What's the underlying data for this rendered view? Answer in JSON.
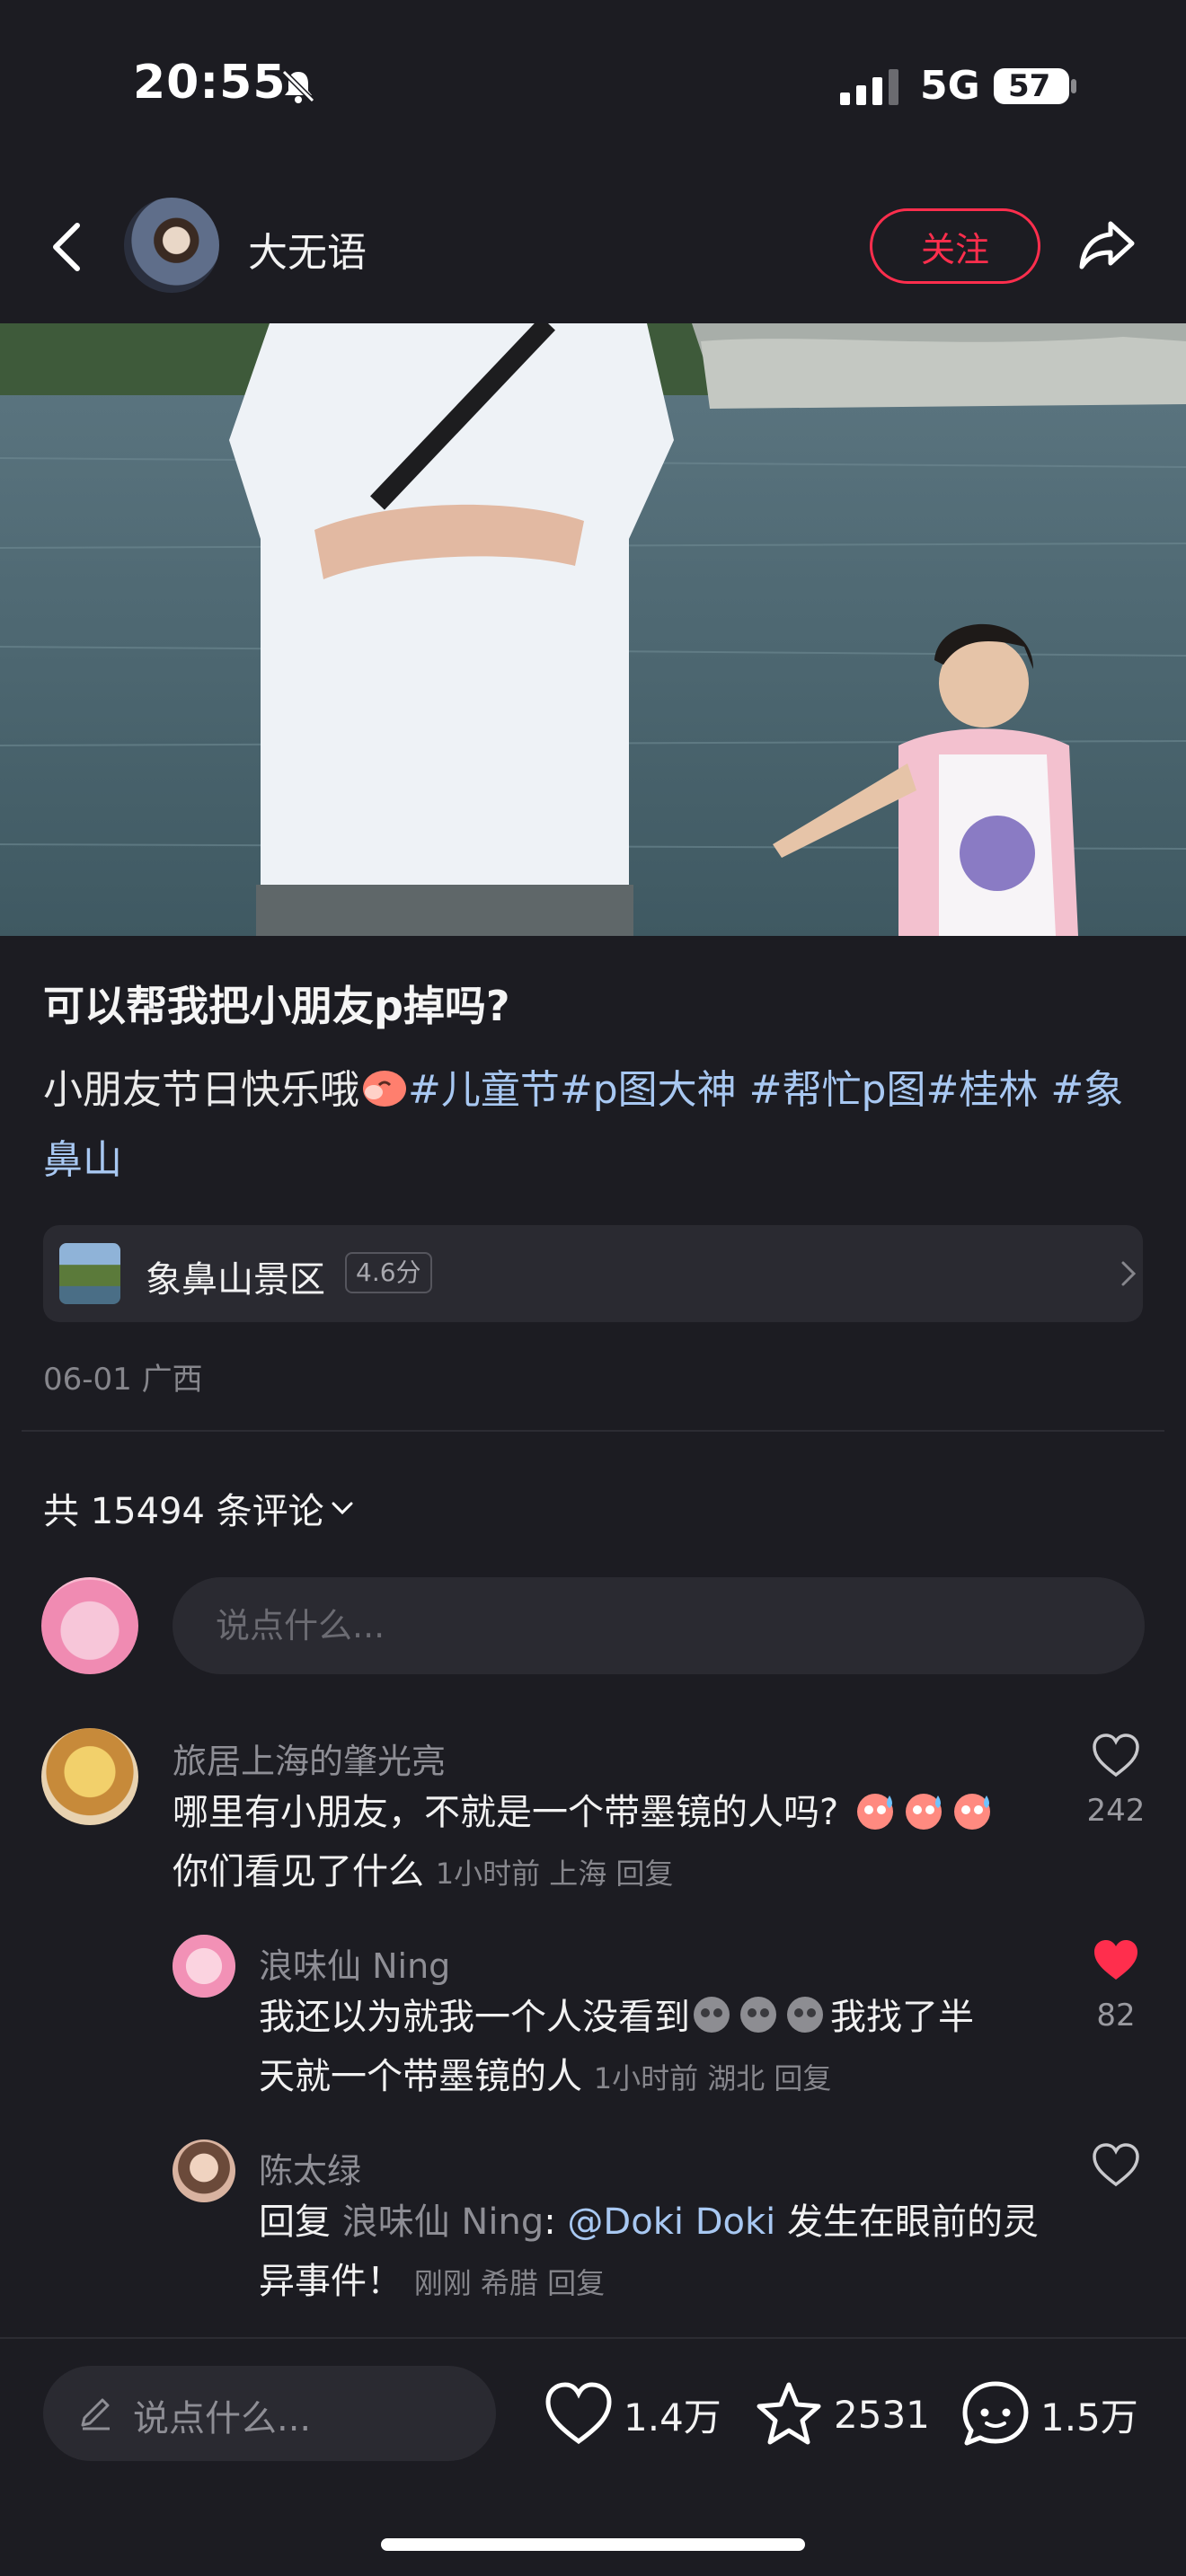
{
  "status_bar": {
    "time": "20:55",
    "network": "5G",
    "battery": "57"
  },
  "nav": {
    "author_name": "大无语",
    "follow_label": "关注"
  },
  "post": {
    "title": "可以帮我把小朋友p掉吗?",
    "body_text": "小朋友节日快乐哦",
    "tags": [
      "#儿童节",
      "#p图大神",
      "#帮忙p图",
      "#桂林",
      "#象鼻山"
    ],
    "date_location": "06-01 广西"
  },
  "location": {
    "name": "象鼻山景区",
    "score": "4.6分"
  },
  "comments": {
    "count_label": "共 15494 条评论",
    "input_placeholder": "说点什么...",
    "items": [
      {
        "user": "旅居上海的肇光亮",
        "text": "哪里有小朋友，不就是一个带墨镜的人吗?",
        "text2": "你们看见了什么",
        "meta": "1小时前 上海 回复",
        "likes": "242",
        "liked": false
      },
      {
        "user": "浪味仙 Ning",
        "text": "我还以为就我一个人没看到",
        "text_cont": "我找了半",
        "text2": "天就一个带墨镜的人",
        "meta": "1小时前 湖北 回复",
        "likes": "82",
        "liked": true
      },
      {
        "user": "陈太绿",
        "reply_prefix": "回复",
        "reply_to": "浪味仙 Ning",
        "text_colon": ": ",
        "mention": "@Doki Doki",
        "text": " 发生在眼前的灵",
        "text2": "异事件！",
        "meta": "刚刚 希腊 回复",
        "liked": false
      }
    ]
  },
  "bottom_bar": {
    "input_placeholder": "说点什么...",
    "likes": "1.4万",
    "favorites": "2531",
    "comments": "1.5万"
  },
  "colors": {
    "accent": "#ff2e4d",
    "tag": "#a8c8f2",
    "background": "#1c1c22"
  }
}
